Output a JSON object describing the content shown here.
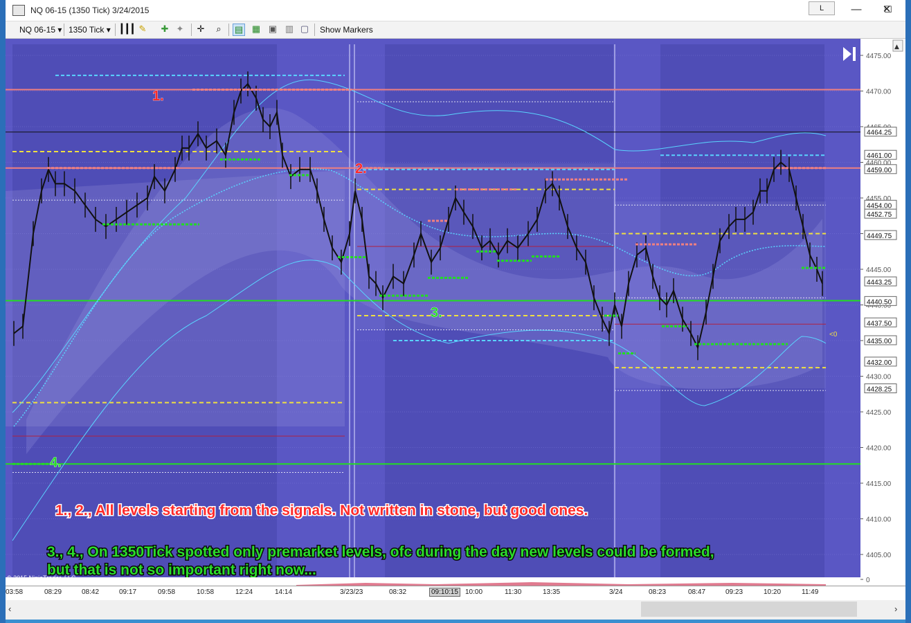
{
  "window": {
    "title": "NQ 06-15 (1350 Tick)  3/24/2015",
    "link_button": "L",
    "minimize": "—",
    "maximize": "☐",
    "close": "✕"
  },
  "toolbar": {
    "instrument": "NQ 06-15",
    "interval": "1350 Tick",
    "show_markers": "Show Markers"
  },
  "chart": {
    "price_labels": [
      "4475.00",
      "4470.00",
      "4465.00",
      "4460.00",
      "4455.00",
      "4450.00",
      "4445.00",
      "4440.00",
      "4435.00",
      "4430.00",
      "4425.00",
      "4420.00",
      "4415.00",
      "4410.00",
      "4405.00",
      "0"
    ],
    "price_tags": [
      "4464.25",
      "4461.00",
      "4459.00",
      "4454.00",
      "4452.75",
      "4449.75",
      "4443.25",
      "4440.50",
      "4437.50",
      "4435.00",
      "4432.00",
      "4428.25"
    ],
    "time_labels": [
      "03:58",
      "08:29",
      "08:42",
      "09:17",
      "09:58",
      "10:58",
      "12:24",
      "14:14",
      "3/23/23",
      "08:32",
      "10:00",
      "11:30",
      "13:35",
      "3/24",
      "08:23",
      "08:47",
      "09:23",
      "10:20",
      "11:49"
    ],
    "crosshair_time": "09:10:15",
    "marker_labels": [
      "1.",
      "2.",
      "3.",
      "4."
    ],
    "note_red": "1., 2., All levels starting from the signals. Not written in stone, but good ones.",
    "note_green_1": "3., 4., On 1350Tick spotted only premarket levels, ofc during the day new levels could be formed,",
    "note_green_2": "but that is not so important right now...",
    "copyright": "© 2015 NinjaTrader, LLC",
    "small_marker": "<0",
    "colors": {
      "background": "#5a57c4",
      "session_shade": "#4a48b0",
      "red_level": "#f08080",
      "green_level": "#22dd22",
      "yellow_level": "#f0e040",
      "cyan_line": "#5ad4ff",
      "note_red": "#ff2a2a",
      "note_green": "#2bdc2b"
    }
  }
}
